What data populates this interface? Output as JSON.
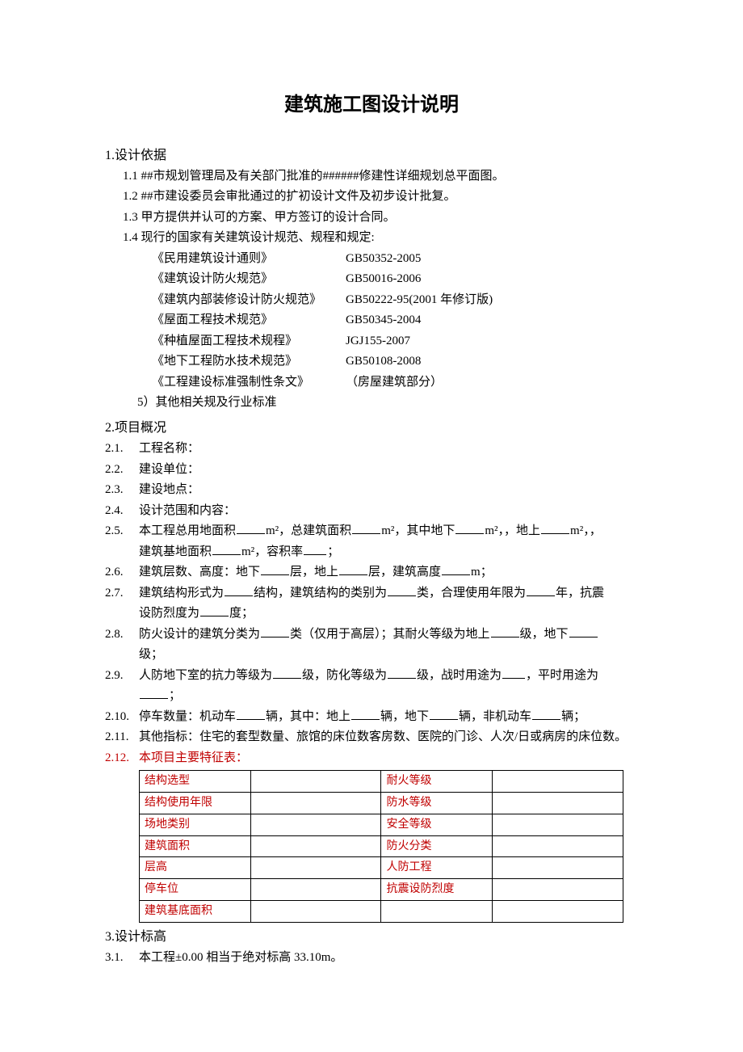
{
  "title": "建筑施工图设计说明",
  "s1": {
    "head": "1.设计依据",
    "i1": "1.1  ##市规划管理局及有关部门批准的######修建性详细规划总平面图。",
    "i2": "1.2  ##市建设委员会审批通过的扩初设计文件及初步设计批复。",
    "i3": "1.3  甲方提供并认可的方案、甲方签订的设计合同。",
    "i4": "1.4  现行的国家有关建筑设计规范、规程和规定:",
    "stds": [
      {
        "name": "《民用建筑设计通则》",
        "code": "GB50352-2005"
      },
      {
        "name": "《建筑设计防火规范》",
        "code": "GB50016-2006"
      },
      {
        "name": "《建筑内部装修设计防火规范》",
        "code": "GB50222-95(2001 年修订版)"
      },
      {
        "name": "《屋面工程技术规范》",
        "code": "GB50345-2004"
      },
      {
        "name": "《种植屋面工程技术规程》",
        "code": "JGJ155-2007"
      },
      {
        "name": "《地下工程防水技术规范》",
        "code": "GB50108-2008"
      },
      {
        "name": "《工程建设标准强制性条文》",
        "code": "（房屋建筑部分）"
      }
    ],
    "i5": "5）其他相关规及行业标准"
  },
  "s2": {
    "head": "2.项目概况",
    "items": {
      "n1": "2.1.",
      "t1": "工程名称：",
      "n2": "2.2.",
      "t2": "建设单位：",
      "n3": "2.3.",
      "t3": "建设地点：",
      "n4": "2.4.",
      "t4": "设计范围和内容：",
      "n5": "2.5.",
      "t5a": "本工程总用地面积",
      "t5b": "m²，总建筑面积",
      "t5c": "m²，其中地下",
      "t5d": "m²，，地上",
      "t5e": "m²，，",
      "t5f": "建筑基地面积",
      "t5g": "m²，容积率",
      "t5h": "；",
      "n6": "2.6.",
      "t6a": "建筑层数、高度：地下",
      "t6b": "层，地上",
      "t6c": "层，建筑高度",
      "t6d": "m；",
      "n7": "2.7.",
      "t7a": "建筑结构形式为",
      "t7b": "结构，建筑结构的类别为",
      "t7c": "类，合理使用年限为",
      "t7d": "年，抗震",
      "t7e": "设防烈度为",
      "t7f": "度；",
      "n8": "2.8.",
      "t8a": "防火设计的建筑分类为",
      "t8b": "类（仅用于高层）；其耐火等级为地上",
      "t8c": "级，地下",
      "t8d": "",
      "t8e": "级；",
      "n9": "2.9.",
      "t9a": "人防地下室的抗力等级为",
      "t9b": "级，防化等级为",
      "t9c": "级，战时用途为",
      "t9d": "，平时用途为",
      "t9e": "；",
      "n10": "2.10.",
      "t10a": "停车数量：机动车",
      "t10b": "辆，其中：地上",
      "t10c": "辆，地下",
      "t10d": "辆，非机动车",
      "t10e": "辆；",
      "n11": "2.11.",
      "t11": "其他指标：住宅的套型数量、旅馆的床位数客房数、医院的门诊、人次/日或病房的床位数。",
      "n12": "2.12.",
      "t12": "本项目主要特征表："
    },
    "table": [
      {
        "l1": "结构选型",
        "l2": "耐火等级"
      },
      {
        "l1": "结构使用年限",
        "l2": "防水等级"
      },
      {
        "l1": "场地类别",
        "l2": "安全等级"
      },
      {
        "l1": "建筑面积",
        "l2": "防火分类"
      },
      {
        "l1": "层高",
        "l2": "人防工程"
      },
      {
        "l1": "停车位",
        "l2": "抗震设防烈度"
      },
      {
        "l1": "建筑基底面积",
        "l2": ""
      }
    ]
  },
  "s3": {
    "head": "3.设计标高",
    "n1": "3.1.",
    "t1": "本工程±0.00 相当于绝对标高 33.10m。"
  }
}
